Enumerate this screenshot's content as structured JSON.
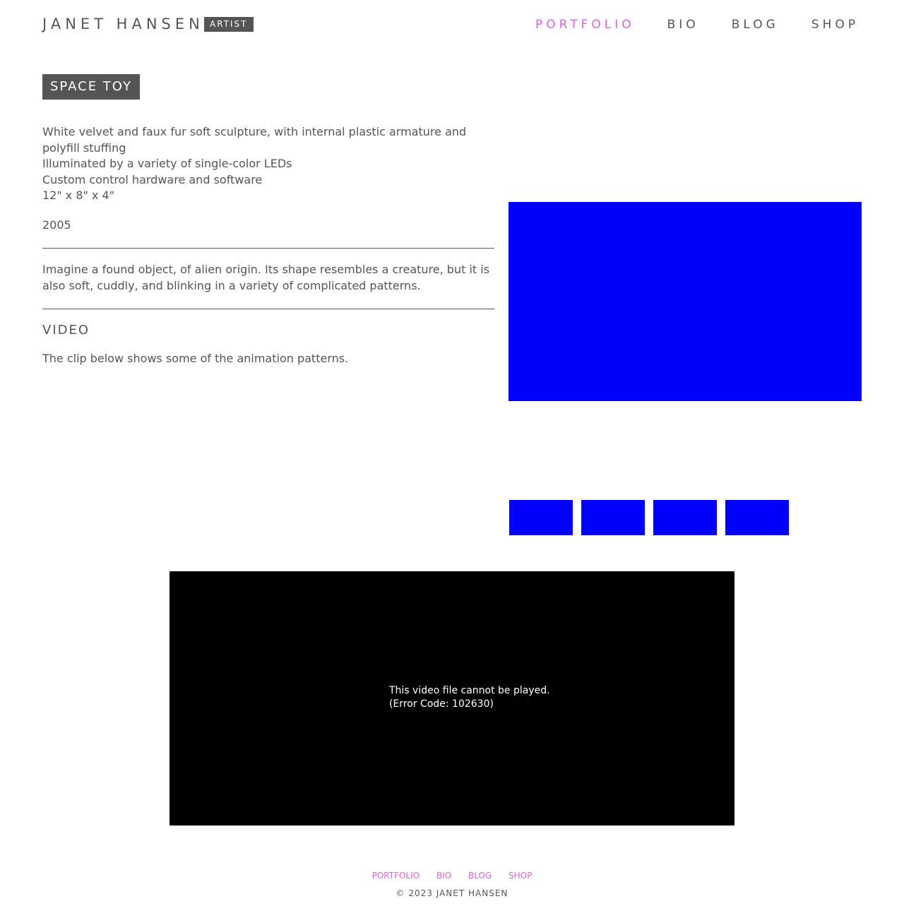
{
  "header": {
    "site_name": "JANET HANSEN",
    "site_badge": "ARTIST",
    "nav": [
      {
        "label": "PORTFOLIO",
        "active": true
      },
      {
        "label": "BIO",
        "active": false
      },
      {
        "label": "BLOG",
        "active": false
      },
      {
        "label": "SHOP",
        "active": false
      }
    ]
  },
  "artwork": {
    "title": "SPACE TOY",
    "specs": [
      "White velvet and faux fur soft sculpture, with internal plastic armature and polyfill stuffing",
      "Illuminated by a variety of single-color LEDs",
      "Custom control hardware and software",
      "12\" x 8\" x 4\""
    ],
    "year": "2005",
    "description": "Imagine a found object, of alien origin. Its shape resembles a creature, but it is also soft, cuddly, and blinking in a variety of complicated patterns.",
    "video_heading": "VIDEO",
    "video_caption": "The clip below shows some of the animation patterns."
  },
  "gallery": {
    "image_color": "#0000ff",
    "thumbnail_count": 4
  },
  "video": {
    "error_line1": "This video file cannot be played.",
    "error_line2": "(Error Code: 102630)"
  },
  "footer": {
    "nav": [
      "PORTFOLIO",
      "BIO",
      "BLOG",
      "SHOP"
    ],
    "copyright": "© 2023 JANET HANSEN"
  },
  "colors": {
    "text": "#555555",
    "accent": "#de5fd9",
    "badge_bg": "#555555",
    "video_bg": "#000000"
  }
}
